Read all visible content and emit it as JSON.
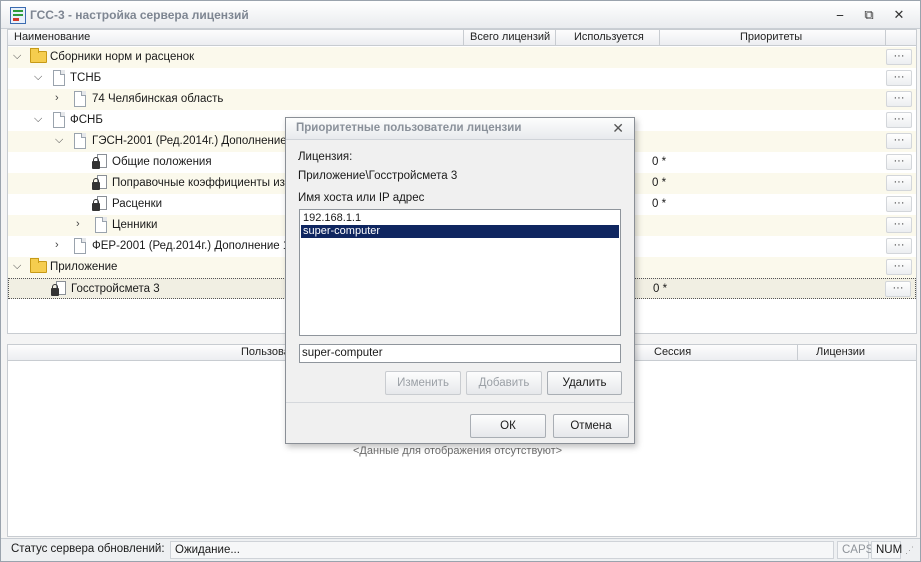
{
  "window": {
    "title": "ГСС-3 - настройка сервера лицензий",
    "min": "⎯",
    "restore": "⧉",
    "close": "✕"
  },
  "grid": {
    "columns": [
      "Наименование",
      "Всего лицензий",
      "Используется",
      "Приоритеты"
    ],
    "rows": [
      {
        "label": "Сборники норм и расценок",
        "priority": ""
      },
      {
        "label": "ТСНБ",
        "priority": ""
      },
      {
        "label": "74 Челябинская область",
        "priority": ""
      },
      {
        "label": "ФСНБ",
        "priority": ""
      },
      {
        "label": "ГЭСН-2001 (Ред.2014г.) Дополнение 1",
        "priority": ""
      },
      {
        "label": "Общие положения",
        "priority": "0 *"
      },
      {
        "label": "Поправочные коэффициенты из О",
        "priority": "0 *"
      },
      {
        "label": "Расценки",
        "priority": "0 *"
      },
      {
        "label": "Ценники",
        "priority": ""
      },
      {
        "label": "ФЕР-2001 (Ред.2014г.) Дополнение 1",
        "priority": ""
      },
      {
        "label": "Приложение",
        "priority": ""
      },
      {
        "label": "Госстройсмета 3",
        "priority": "0 *"
      }
    ],
    "dots": "···"
  },
  "sessions": {
    "columns": [
      "Пользова",
      "Сессия",
      "Лицензии"
    ],
    "empty_text": "<Данные для отображения отсутствуют>"
  },
  "status": {
    "label": "Статус сервера обновлений:",
    "value": "Ожидание...",
    "caps": "CAPS",
    "num": "NUM"
  },
  "dialog": {
    "title": "Приоритетные пользователи лицензии",
    "license_label": "Лицензия:",
    "license_value": "Приложение\\Госстройсмета 3",
    "host_label": "Имя хоста или IP адрес",
    "hosts": [
      "192.168.1.1",
      "super-computer"
    ],
    "input_value": "super-computer",
    "btn_change": "Изменить",
    "btn_add": "Добавить",
    "btn_delete": "Удалить",
    "btn_ok": "ОК",
    "btn_cancel": "Отмена"
  },
  "colors": {
    "selection": "#0f2660",
    "folder": "#f5cd4e"
  }
}
